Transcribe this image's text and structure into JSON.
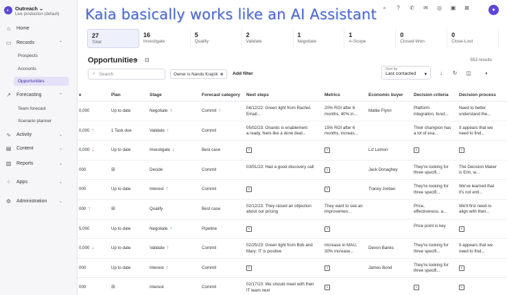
{
  "overlay_title": "Kaia basically works like an AI Assistant",
  "org": {
    "name": "Outreach",
    "caret": "⌄",
    "subtitle": "Live production (default)"
  },
  "sidebar": {
    "items": [
      {
        "label": "Home",
        "icon": "⌂",
        "chev": ""
      },
      {
        "label": "Records",
        "icon": "▭",
        "chev": "⌃"
      },
      {
        "label": "Forecasting",
        "icon": "↗",
        "chev": "⌃"
      },
      {
        "label": "Activity",
        "icon": "∿",
        "chev": "⌄"
      },
      {
        "label": "Content",
        "icon": "▤",
        "chev": "⌄"
      },
      {
        "label": "Reports",
        "icon": "▥",
        "chev": "⌄"
      },
      {
        "label": "Apps",
        "icon": "⁘",
        "chev": "⌄"
      },
      {
        "label": "Administration",
        "icon": "⚙",
        "chev": "⌄"
      }
    ],
    "records_sub": [
      "Prospects",
      "Accounts",
      "Opportunities"
    ],
    "forecasting_sub": [
      "Team forecast",
      "Scenario planner"
    ]
  },
  "topbar": {
    "icons": [
      "⌕",
      "?",
      "✆",
      "✉",
      "◎",
      "▣",
      "⊠"
    ],
    "avatar": "✦"
  },
  "tiles": [
    {
      "count": "27",
      "label": "Total"
    },
    {
      "count": "16",
      "label": "Investigate"
    },
    {
      "count": "5",
      "label": "Qualify"
    },
    {
      "count": "2",
      "label": "Validate"
    },
    {
      "count": "1",
      "label": "Negotiate"
    },
    {
      "count": "1",
      "label": "A-Scope"
    },
    {
      "count": "0",
      "label": "Closed-Won"
    },
    {
      "count": "0",
      "label": "Close-Lost"
    }
  ],
  "page": {
    "title": "Opportunities",
    "caret": "▾",
    "bookmark": "⊡",
    "results": "553 results"
  },
  "filters": {
    "search_placeholder": "Search",
    "search_icon": "⌕",
    "chip": "Owner is Nando Krajcik",
    "chip_close": "⊗",
    "add_filter": "Add filter"
  },
  "sort": {
    "label": "Sort by",
    "value": "Last contacted",
    "caret": "▾"
  },
  "tools": [
    "↓",
    "↻",
    "◫",
    "◑"
  ],
  "columns": [
    "e",
    "Plan",
    "Stage",
    "Forecast category",
    "Next steps",
    "Metrics",
    "Economic buyer",
    "Decision criteria",
    "Decision process"
  ],
  "rows": [
    {
      "amount": "0,000",
      "amount_arrow": "",
      "plan": "Up to date",
      "plan_icon": "",
      "stage": "Negotiate",
      "stage_arrow": "up",
      "forecast": "Commit",
      "forecast_arrow": "up",
      "next1": "04/12/22: Green light from Rachel.",
      "next2": "Email...",
      "metrics1": "20% ROI after 6",
      "metrics2": "months, 40% in...",
      "buyer": "Mattie Flynn",
      "criteria1": "Platform",
      "criteria2": "integration, funct...",
      "process1": "Need to better",
      "process2": "understand the..."
    },
    {
      "amount": "0,000",
      "amount_arrow": "up",
      "plan": "1 Task due",
      "plan_icon": "",
      "stage": "Validate",
      "stage_arrow": "up",
      "forecast": "Commit",
      "forecast_arrow": "",
      "next1": "05/02/23: Oriantic is enablement",
      "next2": "a ready, feels like a done deal...",
      "metrics1": "15% ROI after 6",
      "metrics2": "months, increas...",
      "buyer": "",
      "criteria1": "Their champion has",
      "criteria2": "a lot of exa...",
      "process1": "It appears that we",
      "process2": "need to find..."
    },
    {
      "amount": "0,000",
      "amount_arrow": "down",
      "plan": "Up to date",
      "plan_icon": "",
      "stage": "Investigate",
      "stage_arrow": "down",
      "forecast": "Best case",
      "forecast_arrow": "",
      "next1": "",
      "next2": "",
      "metrics1": "",
      "metrics2": "",
      "buyer": "Liz Lemon",
      "criteria1": "",
      "criteria2": "",
      "process1": "",
      "process2": ""
    },
    {
      "amount": "000",
      "amount_arrow": "",
      "plan": "",
      "plan_icon": "map",
      "stage": "Decide",
      "stage_arrow": "",
      "forecast": "Commit",
      "forecast_arrow": "",
      "next1": "03/01/23: Had a good discovery call",
      "next2": "",
      "metrics1": "",
      "metrics2": "",
      "buyer": "Jack Donaghey",
      "criteria1": "They're looking for",
      "criteria2": "three specifi...",
      "process1": "The Decision Maker",
      "process2": "is Erin, w..."
    },
    {
      "amount": "000",
      "amount_arrow": "",
      "plan": "Up to date",
      "plan_icon": "",
      "stage": "Interest",
      "stage_arrow": "up",
      "forecast": "Commit",
      "forecast_arrow": "",
      "next1": "",
      "next2": "",
      "metrics1": "",
      "metrics2": "",
      "buyer": "Tracey Jordan",
      "criteria1": "They're looking for",
      "criteria2": "three specifi...",
      "process1": "We've learned that",
      "process2": "it's not enti..."
    },
    {
      "amount": "000",
      "amount_arrow": "up",
      "plan": "",
      "plan_icon": "map",
      "stage": "Qualify",
      "stage_arrow": "",
      "forecast": "Best case",
      "forecast_arrow": "",
      "next1": "02/12/23: They raised an objection",
      "next2": "about our pricing",
      "metrics1": "They want to see an",
      "metrics2": "improvemen...",
      "buyer": "",
      "criteria1": "Price,",
      "criteria2": "effectiveness, a...",
      "process1": "We'll first need to",
      "process2": "align with their..."
    },
    {
      "amount": "5,000",
      "amount_arrow": "",
      "plan": "Up to date",
      "plan_icon": "",
      "stage": "Negotiate",
      "stage_arrow": "up",
      "forecast": "Pipeline",
      "forecast_arrow": "",
      "next1": "",
      "next2": "",
      "metrics1": "",
      "metrics2": "",
      "buyer": "",
      "criteria1": "Price point is key",
      "criteria2": "",
      "process1": "",
      "process2": ""
    },
    {
      "amount": "0,000",
      "amount_arrow": "down",
      "plan": "Up to date",
      "plan_icon": "",
      "stage": "Validate",
      "stage_arrow": "up",
      "forecast": "Commit",
      "forecast_arrow": "",
      "next1": "02/25/23: Green light from Bob and",
      "next2": "Mary; IT is positive",
      "metrics1": "Increase in MAU,",
      "metrics2": "30% increase...",
      "buyer": "Devon Banks",
      "criteria1": "They're looking for",
      "criteria2": "three specifi...",
      "process1": "It appears that we",
      "process2": "need to find..."
    },
    {
      "amount": "000",
      "amount_arrow": "",
      "plan": "Up to date",
      "plan_icon": "",
      "stage": "Interest",
      "stage_arrow": "up",
      "forecast": "Commit",
      "forecast_arrow": "",
      "next1": "",
      "next2": "",
      "metrics1": "",
      "metrics2": "",
      "buyer": "James Bond",
      "criteria1": "They're looking for",
      "criteria2": "three specifi...",
      "process1": "",
      "process2": ""
    },
    {
      "amount": "000",
      "amount_arrow": "",
      "plan": "",
      "plan_icon": "map",
      "stage": "Interest",
      "stage_arrow": "",
      "forecast": "Commit",
      "forecast_arrow": "",
      "next1": "02/17/23: We should meet with their",
      "next2": "IT team next",
      "metrics1": "",
      "metrics2": "",
      "buyer": "",
      "criteria1": "",
      "criteria2": "",
      "process1": "",
      "process2": ""
    }
  ],
  "colors": {
    "accent": "#5b46d6",
    "up": "#1f8a5c",
    "down": "#d23b3b",
    "overlay": "#4f6bd0"
  }
}
